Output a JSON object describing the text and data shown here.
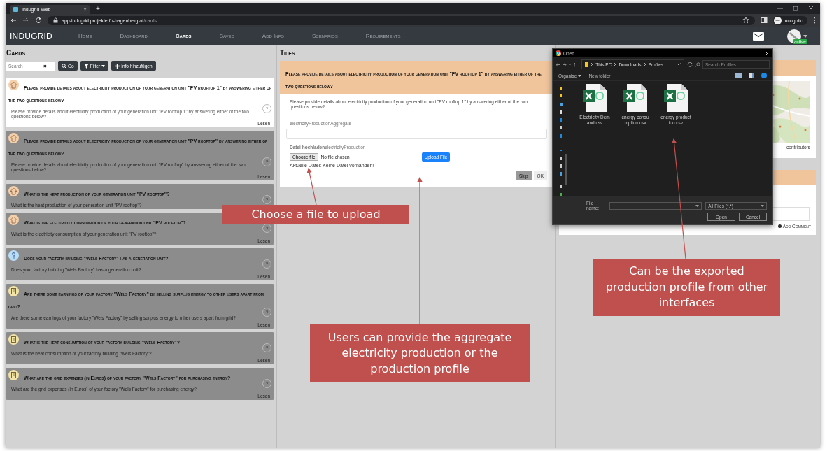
{
  "browser": {
    "tab_title": "Indugrid Web",
    "tab_close": "×",
    "new_tab": "+",
    "url_host": "app-indugrid.projekte.fh-hagenberg.at",
    "url_path": "/cards",
    "profile": "Incognito"
  },
  "navbar": {
    "brand": "INDUGRID",
    "user_status": "active",
    "items": [
      {
        "label": "Home",
        "selected": false
      },
      {
        "label": "Dashboard",
        "selected": false
      },
      {
        "label": "Cards",
        "selected": true
      },
      {
        "label": "Saved",
        "selected": false
      },
      {
        "label": "Add Info",
        "selected": false
      },
      {
        "label": "Scenarios",
        "selected": false
      },
      {
        "label": "Requirements",
        "selected": false
      }
    ]
  },
  "cards_panel": {
    "heading": "Cards",
    "search": {
      "placeholder": "Search"
    },
    "clear": "×",
    "buttons": [
      {
        "kind": "search",
        "label": "Go"
      },
      {
        "kind": "filter",
        "label": "Filter"
      },
      {
        "kind": "add",
        "label": "Info hinzufügen"
      }
    ],
    "cards": [
      {
        "kind": "house",
        "selected": true,
        "title": "Please provide details about electricity production of your generation unit \"PV rooftop 1\" by answering either of the two questions below?",
        "text": "Please provide details about electricity production of your generation unit \"PV rooftop 1\" by answering either of the two questions below?",
        "help": "?",
        "footer": "Lesen"
      },
      {
        "kind": "house",
        "selected": false,
        "title": "Please provide details about electricity production of your generation unit \"PV rooftop\" by answering either of the two questions below?",
        "text": "Please provide details about electricity production of your generation unit \"PV rooftop\" by answering either of the two questions below?",
        "help": "?",
        "footer": "Lesen"
      },
      {
        "kind": "house",
        "selected": false,
        "title": "What is the heat production of your generation unit \"PV rooftop\"?",
        "text": "What is the heat production of your generation unit \"PV rooftop\"?",
        "help": "?"
      },
      {
        "kind": "house",
        "selected": false,
        "title": "What is the electricity consumption of your generation unit \"PV rooftop\"?",
        "text": "What is the electricity consumption of your generation unit \"PV rooftop\"?",
        "help": "?",
        "footer": "Lesen"
      },
      {
        "kind": "question",
        "selected": false,
        "title": "Does your factory building \"Wels Factory\" has a generation unit?",
        "text": "Does your factory building \"Wels Factory\" has a generation unit?",
        "help": "?",
        "footer": "Lesen"
      },
      {
        "kind": "document",
        "selected": false,
        "title": "Are there some earnings of your factory \"Wels Factory\" by selling surplus energy to other users apart from grid?",
        "text": "Are there some earnings of your factory \"Wels Factory\" by selling surplus energy to other users apart from grid?",
        "help": "?",
        "footer": "Lesen"
      },
      {
        "kind": "document",
        "selected": false,
        "title": "What is the heat consumption of your factory building \"Wels Factory\"?",
        "text": "What is the heat consumption of your factory building \"Wels Factory\"?",
        "help": "?",
        "footer": "Lesen"
      },
      {
        "kind": "document",
        "selected": false,
        "title": "What are the grid expenses (in Euros) of your factory \"Wels Factory\" for purchasing energy?",
        "text": "What are the grid expenses (in Euros) of your factory \"Wels Factory\" for purchasing energy?",
        "help": "?",
        "footer": "Lesen"
      }
    ]
  },
  "tiles_panel": {
    "heading": "Tiles",
    "tile": {
      "title": "Please provide details about electricity production of your generation unit \"PV rooftop 1\" by answering either of the two questions below?",
      "text": "Please provide details about electricity production of your generation unit \"PV rooftop 1\" by answering either of the two questions below?",
      "aggregate_label": "electricityProductionAggregate",
      "upload_label": "**Datei hochladen**electricityProduction",
      "choose_button": "Choose file",
      "no_file": "No file chosen",
      "upload_button": "Upload File",
      "current_file": "Aktuelle Datei: Keine Datei vorhanden!",
      "skip_button": "Skip",
      "ok_button": "OK"
    }
  },
  "right_panel": {
    "map_credit": "contributors",
    "comment_button": "Add Comment"
  },
  "file_dialog": {
    "title": "Open",
    "path": [
      "This PC",
      "Downloads",
      "Profiles"
    ],
    "search": {
      "placeholder": "Search Profiles"
    },
    "organise": "Organise",
    "new_folder": "New folder",
    "files": [
      {
        "name": "Electricity Demand.csv"
      },
      {
        "name": "energy consumption.csv"
      },
      {
        "name": "energy production.csv"
      }
    ],
    "file_name_label": "File name:",
    "file_type": "All Files (*.*)",
    "open_button": "Open",
    "cancel_button": "Cancel"
  },
  "annotations": [
    {
      "text": "Choose a file to upload"
    },
    {
      "text": "Users can provide the aggregate electricity production or the production profile"
    },
    {
      "text": "Can be the exported production profile from other interfaces"
    }
  ]
}
